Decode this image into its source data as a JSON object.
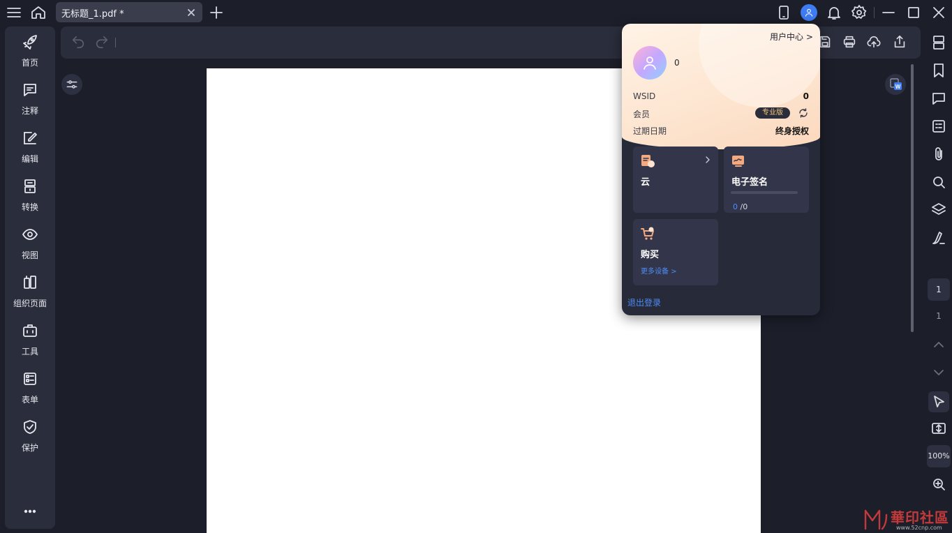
{
  "titlebar": {
    "tab_label": "无标题_1.pdf *"
  },
  "sidebar": {
    "items": [
      {
        "label": "首页",
        "icon": "rocket-icon"
      },
      {
        "label": "注释",
        "icon": "comment-icon"
      },
      {
        "label": "编辑",
        "icon": "edit-icon"
      },
      {
        "label": "转换",
        "icon": "convert-icon"
      },
      {
        "label": "视图",
        "icon": "eye-icon"
      },
      {
        "label": "组织页面",
        "icon": "organize-pages-icon"
      },
      {
        "label": "工具",
        "icon": "toolbox-icon"
      },
      {
        "label": "表单",
        "icon": "form-icon"
      },
      {
        "label": "保护",
        "icon": "shield-icon"
      }
    ]
  },
  "viewer": {
    "current_page": "1",
    "total_pages": "1",
    "zoom": "100%"
  },
  "popup": {
    "user_center": "用户中心 >",
    "user_name": "0",
    "wsid_label": "WSID",
    "wsid_value": "0",
    "member_label": "会员",
    "member_badge": "专业版",
    "expiry_label": "过期日期",
    "expiry_value": "终身授权",
    "cloud_title": "云",
    "sign_title": "电子签名",
    "sign_used": "0",
    "sign_total": " /0",
    "sign_progress": 0,
    "buy_title": "购买",
    "more_devices": "更多设备 >",
    "logout": "退出登录"
  },
  "watermark": {
    "text": "華印社區",
    "url": "www.52cnp.com"
  },
  "colors": {
    "background": "#1c1e2a",
    "panel": "#2a2d3b",
    "accent": "#3e7cf3",
    "link": "#4e8cf5",
    "badge_text": "#f3c77e"
  }
}
